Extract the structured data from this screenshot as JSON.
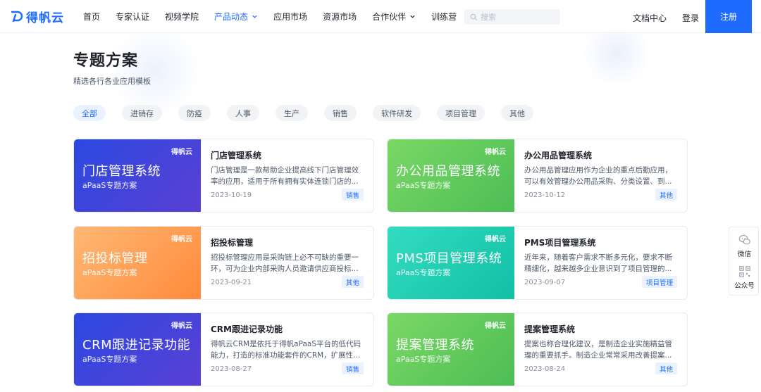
{
  "header": {
    "logo_text": "得帆云",
    "nav": [
      {
        "label": "首页"
      },
      {
        "label": "专家认证"
      },
      {
        "label": "视频学院"
      },
      {
        "label": "产品动态"
      },
      {
        "label": "应用市场"
      },
      {
        "label": "资源市场"
      },
      {
        "label": "合作伙伴"
      },
      {
        "label": "训练营"
      }
    ],
    "search_placeholder": "搜索",
    "docs_label": "文档中心",
    "login_label": "登录",
    "register_label": "注册",
    "accent_color": "#1f6bff"
  },
  "page": {
    "title": "专题方案",
    "subtitle": "精选各行各业应用模板"
  },
  "filters": [
    {
      "label": "全部"
    },
    {
      "label": "进销存"
    },
    {
      "label": "防疫"
    },
    {
      "label": "人事"
    },
    {
      "label": "生产"
    },
    {
      "label": "销售"
    },
    {
      "label": "软件研发"
    },
    {
      "label": "项目管理"
    },
    {
      "label": "其他"
    }
  ],
  "cards": [
    {
      "banner_logo": "得帆云",
      "banner_title": "门店管理系统",
      "banner_sub": "aPaaS专题方案",
      "title": "门店管理系统",
      "desc": "门店管理是一款帮助企业提高线下门店管理效率的应用，适用于所有拥有实体连锁门店的...",
      "date": "2023-10-19",
      "tag": "销售",
      "colors": [
        "#2e45d9",
        "#5a3fd6"
      ]
    },
    {
      "banner_logo": "得帆云",
      "banner_title": "办公用品管理系统",
      "banner_sub": "aPaaS专题方案",
      "title": "办公用品管理系统",
      "desc": "办公用品管理应用作为企业的重点后勤应用，可以有效管理办公用品采购、分类设置、到...",
      "date": "2023-10-12",
      "tag": "其他",
      "colors": [
        "#6fd35f",
        "#4fbf57"
      ]
    },
    {
      "banner_logo": "得帆云",
      "banner_title": "招投标管理",
      "banner_sub": "aPaaS专题方案",
      "title": "招投标管理",
      "desc": "招投标管理应用是采购链上必不可缺的重要一环，可为企业内部采购人员邀请供应商投标...",
      "date": "2023-09-21",
      "tag": "其他",
      "colors": [
        "#ffb06a",
        "#ff8f3f"
      ]
    },
    {
      "banner_logo": "得帆云",
      "banner_title": "PMS项目管理系统",
      "banner_sub": "aPaaS专题方案",
      "title": "PMS项目管理系统",
      "desc": "近年来，随着客户需求不断多元化，要求不断精细化，越来越多企业意识到了项目管理的...",
      "date": "2023-09-07",
      "tag": "项目管理",
      "colors": [
        "#2fd6bb",
        "#14c3a8"
      ]
    },
    {
      "banner_logo": "得帆云",
      "banner_title": "CRM跟进记录功能",
      "banner_sub": "aPaaS专题方案",
      "title": "CRM跟进记录功能",
      "desc": "得帆云CRM是依托于得帆aPaaS平台的低代码能力，打造的标准功能套件的CRM，扩展性...",
      "date": "2023-08-27",
      "tag": "销售",
      "colors": [
        "#2e45d9",
        "#5a3fd6"
      ]
    },
    {
      "banner_logo": "得帆云",
      "banner_title": "提案管理系统",
      "banner_sub": "aPaaS专题方案",
      "title": "提案管理系统",
      "desc": "提案也称合理化建议，是制造企业实施精益管理的重要抓手。制造企业常常采用改善提案...",
      "date": "2023-08-24",
      "tag": "其他",
      "colors": [
        "#6fd35f",
        "#4fbf57"
      ]
    }
  ],
  "side": {
    "wechat_label": "微信",
    "official_label": "公众号"
  }
}
